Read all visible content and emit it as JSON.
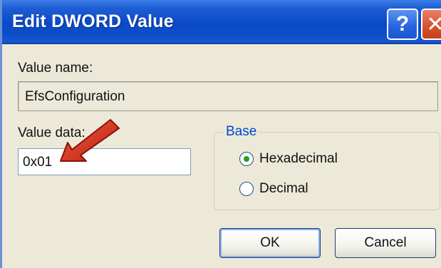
{
  "window": {
    "title": "Edit DWORD Value"
  },
  "titlebar_buttons": {
    "help_label": "?",
    "close_label": "✕"
  },
  "value_name": {
    "label": "Value name:",
    "value": "EfsConfiguration"
  },
  "value_data": {
    "label": "Value data:",
    "value": "0x01"
  },
  "base": {
    "label": "Base",
    "options": [
      {
        "label": "Hexadecimal",
        "selected": true
      },
      {
        "label": "Decimal",
        "selected": false
      }
    ]
  },
  "buttons": {
    "ok_label": "OK",
    "cancel_label": "Cancel"
  },
  "colors": {
    "titlebar": "#0a49c9",
    "dialog_bg": "#ece9d8",
    "arrow": "#d42a1a"
  },
  "annotation": {
    "icon": "red-arrow-icon"
  }
}
